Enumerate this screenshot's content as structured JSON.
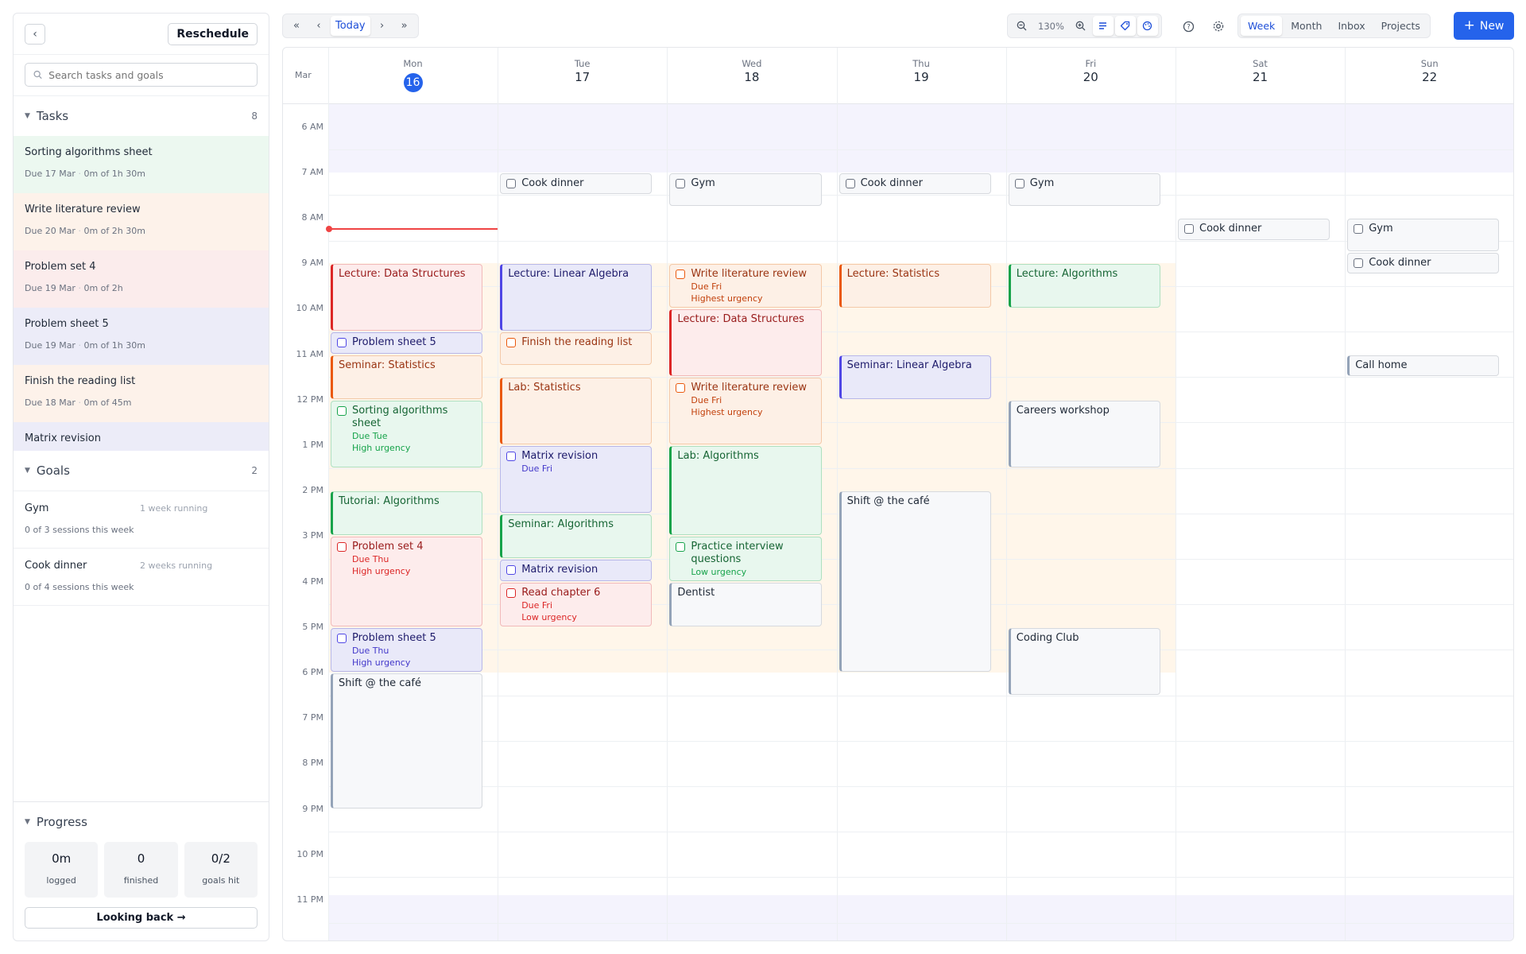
{
  "sidebar": {
    "reschedule_label": "Reschedule",
    "search_placeholder": "Search tasks and goals",
    "tasks_header": "Tasks",
    "tasks_count": "8",
    "tasks": [
      {
        "title": "Sorting algorithms sheet",
        "due": "Due 17 Mar",
        "progress": "0m of 1h 30m",
        "color": "#ecf8f0"
      },
      {
        "title": "Write literature review",
        "due": "Due 20 Mar",
        "progress": "0m of 2h 30m",
        "color": "#fdf2ea"
      },
      {
        "title": "Problem set 4",
        "due": "Due 19 Mar",
        "progress": "0m of 2h",
        "color": "#fbecec"
      },
      {
        "title": "Problem sheet 5",
        "due": "Due 19 Mar",
        "progress": "0m of 1h 30m",
        "color": "#ececf8"
      },
      {
        "title": "Finish the reading list",
        "due": "Due 18 Mar",
        "progress": "0m of 45m",
        "color": "#fdf2ea"
      },
      {
        "title": "Matrix revision",
        "color": "#ececf8"
      }
    ],
    "goals_header": "Goals",
    "goals_count": "2",
    "goals": [
      {
        "name": "Gym",
        "running": "1 week running",
        "sessions": "0 of 3 sessions this week"
      },
      {
        "name": "Cook dinner",
        "running": "2 weeks running",
        "sessions": "0 of 4 sessions this week"
      }
    ],
    "progress_header": "Progress",
    "stats": [
      {
        "value": "0m",
        "label": "logged"
      },
      {
        "value": "0",
        "label": "finished"
      },
      {
        "value": "0/2",
        "label": "goals hit"
      }
    ],
    "looking_back": "Looking back →"
  },
  "toolbar": {
    "today": "Today",
    "zoom": "130%",
    "views": [
      "Week",
      "Month",
      "Inbox",
      "Projects"
    ],
    "active_view": "Week",
    "new_label": "New"
  },
  "calendar": {
    "month": "Mar",
    "days": [
      {
        "name": "Mon",
        "date": "16",
        "today": true
      },
      {
        "name": "Tue",
        "date": "17"
      },
      {
        "name": "Wed",
        "date": "18"
      },
      {
        "name": "Thu",
        "date": "19"
      },
      {
        "name": "Fri",
        "date": "20"
      },
      {
        "name": "Sat",
        "date": "21"
      },
      {
        "name": "Sun",
        "date": "22"
      }
    ],
    "hours": [
      "6 AM",
      "7 AM",
      "8 AM",
      "9 AM",
      "10 AM",
      "11 AM",
      "12 PM",
      "1 PM",
      "2 PM",
      "3 PM",
      "4 PM",
      "5 PM",
      "6 PM",
      "7 PM",
      "8 PM",
      "9 PM",
      "10 PM",
      "11 PM"
    ],
    "events": [
      {
        "day": 0,
        "start": 9.0,
        "end": 10.5,
        "title": "Lecture: Data Structures",
        "color": "red",
        "kind": "event"
      },
      {
        "day": 0,
        "start": 10.5,
        "end": 11.0,
        "title": "Problem sheet 5",
        "color": "blue",
        "kind": "task"
      },
      {
        "day": 0,
        "start": 11.0,
        "end": 12.0,
        "title": "Seminar: Statistics",
        "color": "orange",
        "kind": "event"
      },
      {
        "day": 0,
        "start": 12.0,
        "end": 13.5,
        "title": "Sorting algorithms sheet",
        "sub": [
          "Due Tue",
          "High urgency"
        ],
        "color": "green",
        "kind": "task"
      },
      {
        "day": 0,
        "start": 14.0,
        "end": 15.0,
        "title": "Tutorial: Algorithms",
        "color": "green",
        "kind": "event"
      },
      {
        "day": 0,
        "start": 15.0,
        "end": 17.0,
        "title": "Problem set 4",
        "sub": [
          "Due Thu",
          "High urgency"
        ],
        "color": "red",
        "kind": "task"
      },
      {
        "day": 0,
        "start": 17.0,
        "end": 18.0,
        "title": "Problem sheet 5",
        "sub": [
          "Due Thu",
          "High urgency"
        ],
        "color": "blue",
        "kind": "task"
      },
      {
        "day": 0,
        "start": 18.0,
        "end": 21.0,
        "title": "Shift @ the café",
        "color": "gray",
        "kind": "event"
      },
      {
        "day": 1,
        "start": 7.0,
        "end": 7.5,
        "title": "Cook dinner",
        "color": "gray",
        "kind": "task"
      },
      {
        "day": 1,
        "start": 9.0,
        "end": 10.5,
        "title": "Lecture: Linear Algebra",
        "color": "blue",
        "kind": "event"
      },
      {
        "day": 1,
        "start": 10.5,
        "end": 11.25,
        "title": "Finish the reading list",
        "color": "orange",
        "kind": "task"
      },
      {
        "day": 1,
        "start": 11.5,
        "end": 13.0,
        "title": "Lab: Statistics",
        "color": "orange",
        "kind": "event"
      },
      {
        "day": 1,
        "start": 13.0,
        "end": 14.5,
        "title": "Matrix revision",
        "sub": [
          "Due Fri"
        ],
        "color": "blue",
        "kind": "task"
      },
      {
        "day": 1,
        "start": 14.5,
        "end": 15.5,
        "title": "Seminar: Algorithms",
        "color": "green",
        "kind": "event"
      },
      {
        "day": 1,
        "start": 15.5,
        "end": 16.0,
        "title": "Matrix revision",
        "color": "blue",
        "kind": "task"
      },
      {
        "day": 1,
        "start": 16.0,
        "end": 17.0,
        "title": "Read chapter 6",
        "sub": [
          "Due Fri",
          "Low urgency"
        ],
        "color": "red",
        "kind": "task"
      },
      {
        "day": 2,
        "start": 7.0,
        "end": 7.75,
        "title": "Gym",
        "color": "gray",
        "kind": "task"
      },
      {
        "day": 2,
        "start": 9.0,
        "end": 10.0,
        "title": "Write literature review",
        "sub": [
          "Due Fri",
          "Highest urgency"
        ],
        "color": "orange",
        "kind": "task"
      },
      {
        "day": 2,
        "start": 10.0,
        "end": 11.5,
        "title": "Lecture: Data Structures",
        "color": "red",
        "kind": "event"
      },
      {
        "day": 2,
        "start": 11.5,
        "end": 13.0,
        "title": "Write literature review",
        "sub": [
          "Due Fri",
          "Highest urgency"
        ],
        "color": "orange",
        "kind": "task"
      },
      {
        "day": 2,
        "start": 13.0,
        "end": 15.0,
        "title": "Lab: Algorithms",
        "color": "green",
        "kind": "event"
      },
      {
        "day": 2,
        "start": 15.0,
        "end": 16.0,
        "title": "Practice interview questions",
        "sub": [
          "Low urgency"
        ],
        "color": "green",
        "kind": "task"
      },
      {
        "day": 2,
        "start": 16.0,
        "end": 17.0,
        "title": "Dentist",
        "color": "gray",
        "kind": "event"
      },
      {
        "day": 3,
        "start": 7.0,
        "end": 7.5,
        "title": "Cook dinner",
        "color": "gray",
        "kind": "task"
      },
      {
        "day": 3,
        "start": 9.0,
        "end": 10.0,
        "title": "Lecture: Statistics",
        "color": "orange",
        "kind": "event"
      },
      {
        "day": 3,
        "start": 11.0,
        "end": 12.0,
        "title": "Seminar: Linear Algebra",
        "color": "blue",
        "kind": "event"
      },
      {
        "day": 3,
        "start": 14.0,
        "end": 18.0,
        "title": "Shift @ the café",
        "color": "gray",
        "kind": "event"
      },
      {
        "day": 4,
        "start": 7.0,
        "end": 7.75,
        "title": "Gym",
        "color": "gray",
        "kind": "task"
      },
      {
        "day": 4,
        "start": 9.0,
        "end": 10.0,
        "title": "Lecture: Algorithms",
        "color": "green",
        "kind": "event"
      },
      {
        "day": 4,
        "start": 12.0,
        "end": 13.5,
        "title": "Careers workshop",
        "color": "gray",
        "kind": "event"
      },
      {
        "day": 4,
        "start": 17.0,
        "end": 18.5,
        "title": "Coding Club",
        "color": "gray",
        "kind": "event"
      },
      {
        "day": 5,
        "start": 8.0,
        "end": 8.5,
        "title": "Cook dinner",
        "color": "gray",
        "kind": "task"
      },
      {
        "day": 6,
        "start": 8.0,
        "end": 8.75,
        "title": "Gym",
        "color": "gray",
        "kind": "task"
      },
      {
        "day": 6,
        "start": 8.75,
        "end": 9.25,
        "title": "Cook dinner",
        "color": "gray",
        "kind": "task"
      },
      {
        "day": 6,
        "start": 11.0,
        "end": 11.5,
        "title": "Call home",
        "color": "gray",
        "kind": "event"
      }
    ],
    "work_hours": {
      "days": 5,
      "start": 9.0,
      "end": 18.0,
      "color": "#fff6ea"
    },
    "current_time": 8.25
  }
}
